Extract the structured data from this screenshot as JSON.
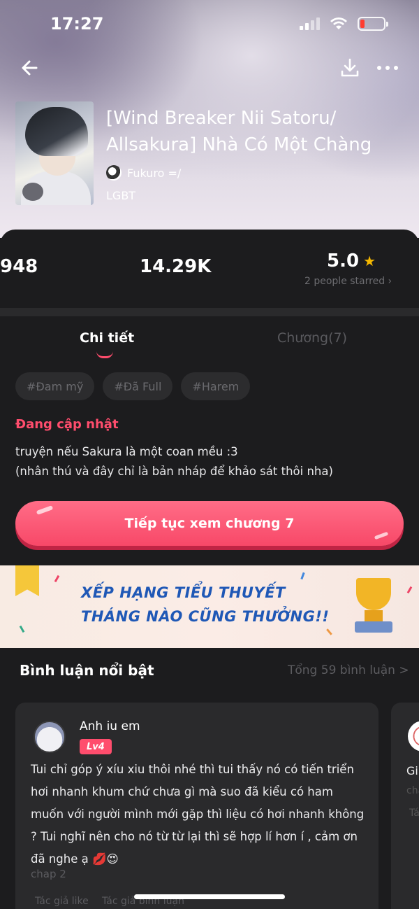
{
  "status_bar": {
    "time": "17:27"
  },
  "header": {
    "title": "[Wind Breaker Nii Satoru/ Allsakura] Nhà Có Một Chàng",
    "author": "Fukuro =/",
    "genre": "LGBT"
  },
  "stats": {
    "stat_1": "948",
    "stat_2": "14.29K",
    "rating": "5.0",
    "rating_sub": "2 people starred ›"
  },
  "tabs": [
    {
      "label": "Chi tiết",
      "active": true
    },
    {
      "label": "Chương(7)",
      "active": false
    }
  ],
  "tags": [
    "#Đam mỹ",
    "#Đã Full",
    "#Harem"
  ],
  "status_label": "Đang cập nhật",
  "description_line1": "truyện nếu Sakura là một coan mều :3",
  "description_line2": "(nhân thú và đây chỉ là bản nháp để khảo sát thôi nha)",
  "continue_button": "Tiếp tục xem chương 7",
  "banner": {
    "line1": "XẾP HẠNG TIỂU THUYẾT",
    "line2": "THÁNG NÀO CŨNG THƯỞNG!!"
  },
  "comments": {
    "header": "Bình luận nổi bật",
    "total": "Tổng 59 bình luận >",
    "items": [
      {
        "user": "Anh iu em",
        "level": "Lv4",
        "text": "Tui chỉ góp ý xíu xiu thôi nhé thì tui thấy nó có tiến triển hơi nhanh khum chứ chưa gì mà suo đã kiểu có ham muốn với người mình mới gặp thì liệu có hơi nhanh không ? Tui nghĩ nên cho nó từ từ lại thì sẽ hợp lí hơn í , cảm ơn đã nghe ạ 💋😍",
        "chapter": "chap 2",
        "tag_1": "Tác giả like",
        "tag_2": "Tác giả bình luận"
      },
      {
        "text_1": "Gi",
        "text_2": "cha",
        "text_3": "Tá"
      }
    ]
  },
  "colors": {
    "accent": "#ff4d6d",
    "background": "#1c1c1e",
    "card": "#2a2a2c",
    "star": "#f5b800"
  }
}
